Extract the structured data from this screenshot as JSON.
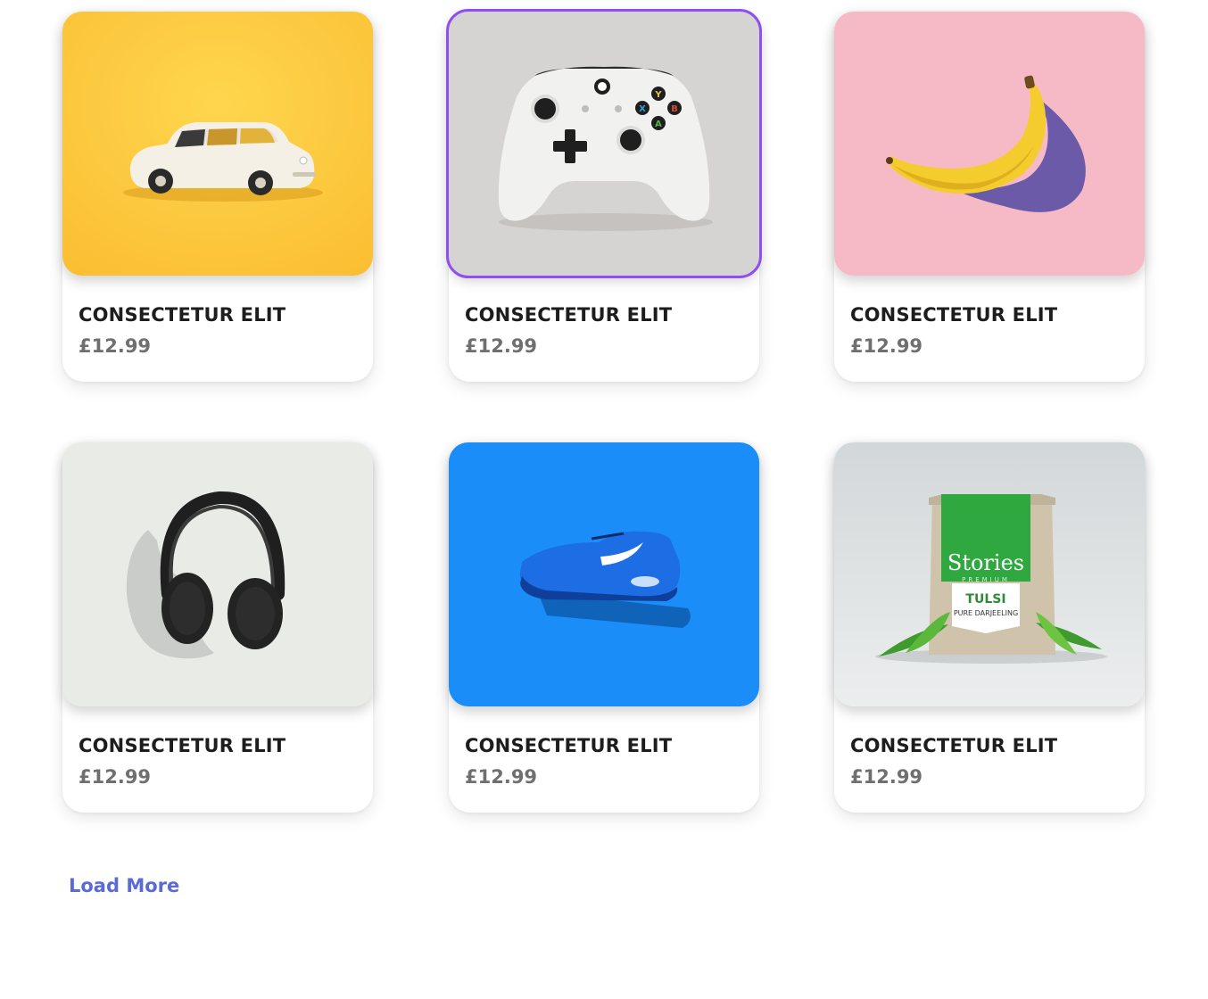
{
  "products": [
    {
      "name": "CONSECTETUR ELIT",
      "price": "£12.99",
      "image": "toy-car-image",
      "bg": "#fdc93e"
    },
    {
      "name": "CONSECTETUR ELIT",
      "price": "£12.99",
      "image": "game-controller-image",
      "bg": "#d6d4d2",
      "selected": true
    },
    {
      "name": "CONSECTETUR ELIT",
      "price": "£12.99",
      "image": "banana-image",
      "bg": "#f6bac7"
    },
    {
      "name": "CONSECTETUR ELIT",
      "price": "£12.99",
      "image": "headphones-image",
      "bg": "#e9ebe7"
    },
    {
      "name": "CONSECTETUR ELIT",
      "price": "£12.99",
      "image": "sneaker-image",
      "bg": "#1a8df8"
    },
    {
      "name": "CONSECTETUR ELIT",
      "price": "£12.99",
      "image": "tea-bag-image",
      "bg": "#dde0e1"
    }
  ],
  "tea_label": {
    "brand": "Stories",
    "tier": "PREMIUM",
    "name": "TULSI",
    "subtitle": "PURE DARJEELING"
  },
  "controller_buttons": {
    "y": "Y",
    "x": "X",
    "b": "B",
    "a": "A"
  },
  "load_more_label": "Load More",
  "colors": {
    "accent": "#8f4ef0",
    "link": "#5b6bd6",
    "title": "#1d1d1d",
    "price": "#6f6f6f"
  }
}
